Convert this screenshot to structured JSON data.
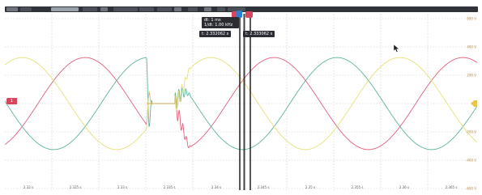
{
  "toolbar": {
    "buttons": [
      "",
      "",
      "",
      "",
      "",
      "",
      "",
      "",
      "",
      "",
      "",
      "",
      ""
    ]
  },
  "cursors": {
    "delta_time": "dt: 1 ms",
    "delta_freq": "1/dt: 1.00 kHz",
    "cursor1_time": "t: 2.332062 s",
    "cursor2_time": "t: 2.333062 s",
    "marker_label": "1"
  },
  "waveforms": {
    "colors": {
      "phase_a": "#e0607a",
      "phase_b": "#5fb59a",
      "phase_c": "#e6e07a",
      "neutral": "#d2a955",
      "grid": "#c9c9c9",
      "cursor": "#111111"
    },
    "frequency_hz": 50,
    "amplitude_v": 325,
    "dropout_start_s": 2.3315,
    "dropout_end_s": 2.3345
  },
  "axes": {
    "x_ticks": [
      "2.32 s",
      "2.325 s",
      "2.33 s",
      "2.335 s",
      "2.34 s",
      "2.345 s",
      "2.35 s",
      "2.355 s",
      "2.36 s",
      "2.365 s"
    ],
    "y_ticks_right": [
      "600 V",
      "400 V",
      "200 V",
      "0 V",
      "-200 V",
      "-400 V",
      "-600 V"
    ]
  }
}
